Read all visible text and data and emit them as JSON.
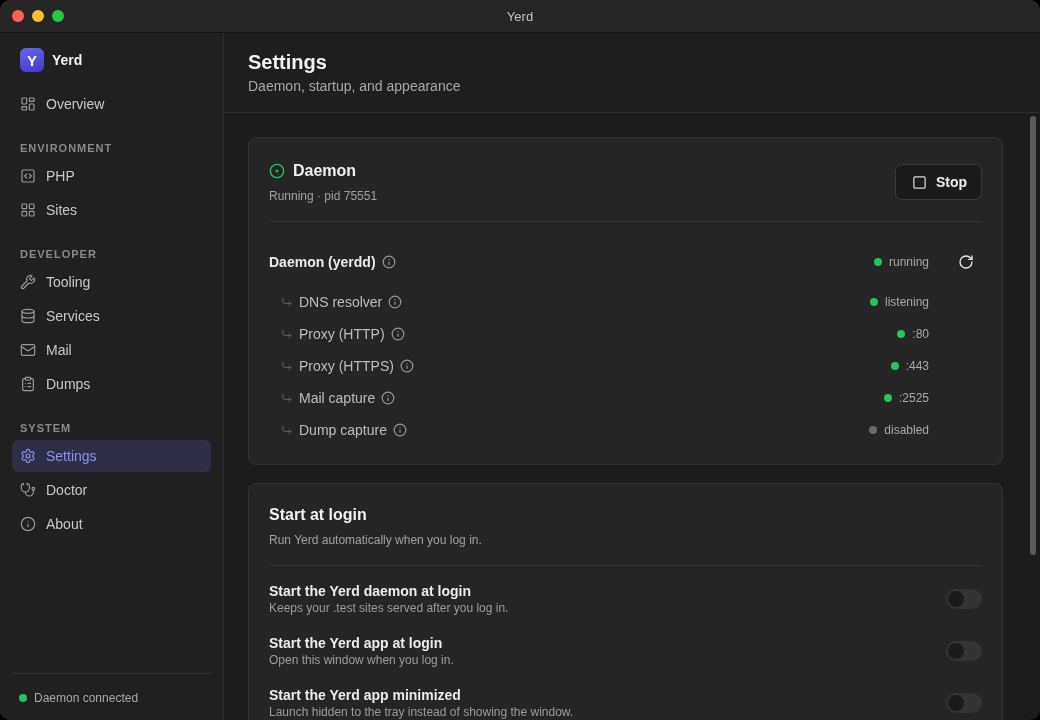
{
  "window": {
    "title": "Yerd"
  },
  "sidebar": {
    "logo_letter": "Y",
    "app_name": "Yerd",
    "sections": [
      {
        "items": [
          {
            "label": "Overview",
            "selected": false
          }
        ]
      },
      {
        "heading": "ENVIRONMENT",
        "items": [
          {
            "label": "PHP",
            "selected": false
          },
          {
            "label": "Sites",
            "selected": false
          }
        ]
      },
      {
        "heading": "DEVELOPER",
        "items": [
          {
            "label": "Tooling",
            "selected": false
          },
          {
            "label": "Services",
            "selected": false
          },
          {
            "label": "Mail",
            "selected": false
          },
          {
            "label": "Dumps",
            "selected": false
          }
        ]
      },
      {
        "heading": "SYSTEM",
        "items": [
          {
            "label": "Settings",
            "selected": true
          },
          {
            "label": "Doctor",
            "selected": false
          },
          {
            "label": "About",
            "selected": false
          }
        ]
      }
    ],
    "status": {
      "label": "Daemon connected",
      "connected": true
    }
  },
  "page": {
    "title": "Settings",
    "subtitle": "Daemon, startup, and appearance"
  },
  "daemon_card": {
    "title": "Daemon",
    "subtitle": "Running · pid 75551",
    "running": true,
    "stop_button": "Stop",
    "process": {
      "name": "Daemon (yerdd)",
      "status": "running",
      "color": "#22c55e",
      "children": [
        {
          "name": "DNS resolver",
          "status": "listening",
          "color": "#22c55e"
        },
        {
          "name": "Proxy (HTTP)",
          "status": ":80",
          "color": "#22c55e"
        },
        {
          "name": "Proxy (HTTPS)",
          "status": ":443",
          "color": "#22c55e"
        },
        {
          "name": "Mail capture",
          "status": ":2525",
          "color": "#22c55e"
        },
        {
          "name": "Dump capture",
          "status": "disabled",
          "color": "#6b6b6b"
        }
      ]
    }
  },
  "login_card": {
    "title": "Start at login",
    "description": "Run Yerd automatically when you log in.",
    "options": [
      {
        "title": "Start the Yerd daemon at login",
        "description": "Keeps your .test sites served after you log in.",
        "on": false
      },
      {
        "title": "Start the Yerd app at login",
        "description": "Open this window when you log in.",
        "on": false
      },
      {
        "title": "Start the Yerd app minimized",
        "description": "Launch hidden to the tray instead of showing the window.",
        "on": false
      }
    ]
  }
}
